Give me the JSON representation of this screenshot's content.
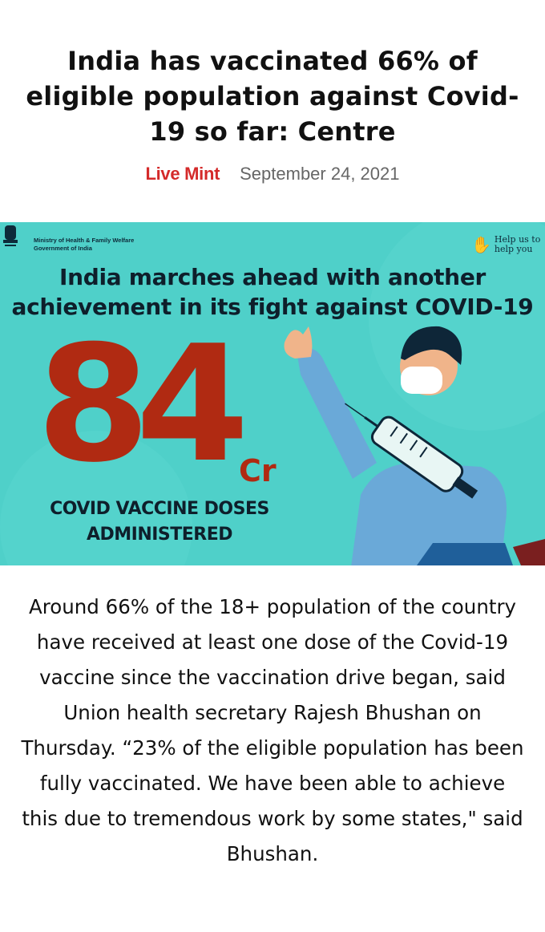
{
  "article": {
    "headline": "India has vaccinated 66% of eligible population against Covid-19 so far: Centre",
    "source": "Live Mint",
    "date": "September 24, 2021",
    "body": "Around 66% of the 18+ population of the country have received at least one dose of the Covid-19 vaccine since the vaccination drive began, said Union health secretary Rajesh Bhushan on Thursday. “23% of the eligible population has been fully vaccinated. We have been able to achieve this due to tremendous work by some states,\" said Bhushan."
  },
  "banner": {
    "ministry_line1": "Ministry of Health & Family Welfare",
    "ministry_line2": "Government of India",
    "help_line1": "Help us to",
    "help_line2": "help you",
    "title_line1": "India marches ahead with another",
    "title_line2": "achievement in its  fight against COVID-19",
    "number": "84",
    "unit": "Cr",
    "caption_line1": "COVID VACCINE DOSES",
    "caption_line2": "ADMINISTERED",
    "background_color": "#4fd0c9",
    "accent_color": "#b02a12"
  },
  "colors": {
    "source": "#d42a2a",
    "date": "#666666"
  }
}
